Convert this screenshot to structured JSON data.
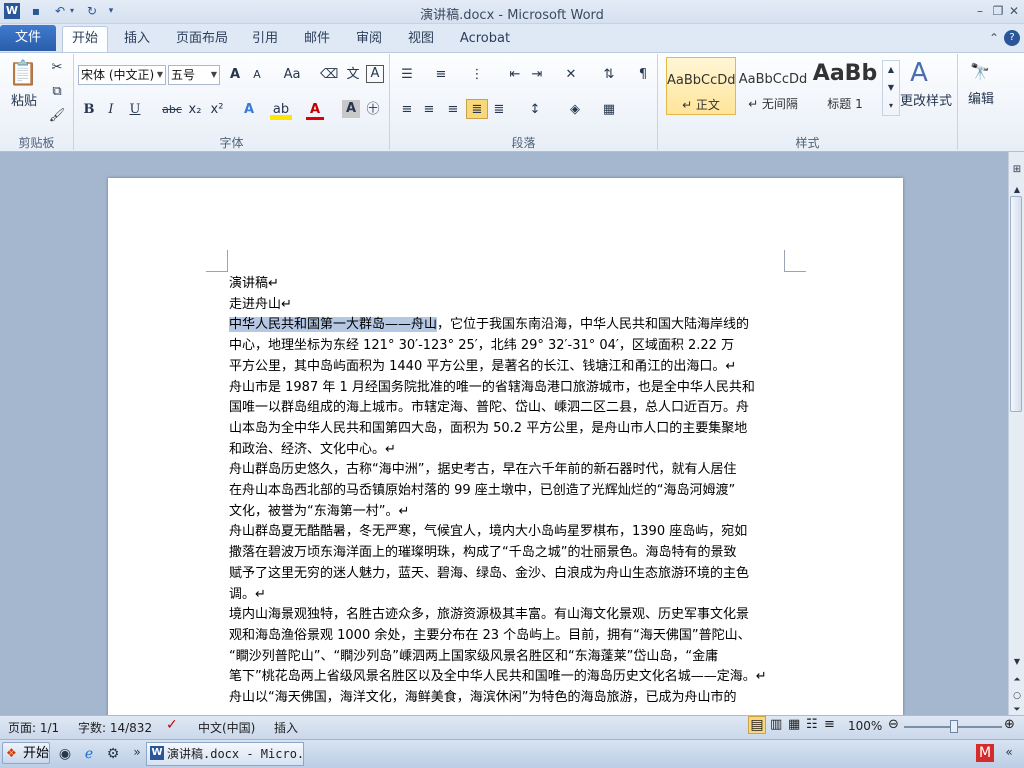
{
  "window": {
    "title": "演讲稿.docx - Microsoft Word"
  },
  "colors": {
    "accent": "#2b579a",
    "file_tab": "#2f65b5",
    "selection": "#b4c7e3",
    "doc_background": "#a5b7cf"
  },
  "tabs": [
    "开始",
    "插入",
    "页面布局",
    "引用",
    "邮件",
    "审阅",
    "视图",
    "Acrobat"
  ],
  "file_tab": "文件",
  "ribbon": {
    "clipboard": {
      "paste": "粘贴",
      "label": "剪贴板"
    },
    "font": {
      "name": "宋体 (中文正)",
      "size": "五号",
      "grow": "A",
      "shrink": "A",
      "case": "Aa",
      "bold": "B",
      "italic": "I",
      "underline": "U",
      "strike": "abc",
      "sub": "x₂",
      "sup": "x²",
      "color_a": "A",
      "highlight": "ab",
      "label": "字体"
    },
    "paragraph": {
      "label": "段落"
    },
    "styles": {
      "items": [
        {
          "preview": "AaBbCcDd",
          "name": "↵ 正文"
        },
        {
          "preview": "AaBbCcDd",
          "name": "↵ 无间隔"
        },
        {
          "preview": "AaBb",
          "name": "标题 1"
        }
      ],
      "change": "更改样式",
      "label": "样式"
    },
    "editing": {
      "label": "编辑"
    }
  },
  "document": {
    "lines": [
      "演讲稿↵",
      "走进舟山↵",
      "中华人民共和国第一大群岛——舟山，它位于我国东南沿海，中华人民共和国大陆海岸线的",
      "中心，地理坐标为东经 121° 30′-123° 25′，北纬 29° 32′-31° 04′，区域面积 2.22 万",
      "平方公里，其中岛屿面积为 1440 平方公里，是著名的长江、钱塘江和甬江的出海口。↵",
      "舟山市是 1987 年 1 月经国务院批准的唯一的省辖海岛港口旅游城市，也是全中华人民共和",
      "国唯一以群岛组成的海上城市。市辖定海、普陀、岱山、嵊泗二区二县，总人口近百万。舟",
      "山本岛为全中华人民共和国第四大岛，面积为 50.2 平方公里，是舟山市人口的主要集聚地",
      "和政治、经济、文化中心。↵",
      "舟山群岛历史悠久，古称“海中洲”，据史考古，早在六千年前的新石器时代，就有人居住",
      "在舟山本岛西北部的马岙镇原始村落的 99 座土墩中，已创造了光辉灿烂的“海岛河姆渡”",
      "文化，被誉为“东海第一村”。↵",
      "舟山群岛夏无酷酷暑，冬无严寒，气候宜人，境内大小岛屿星罗棋布，1390 座岛屿，宛如",
      "撒落在碧波万顷东海洋面上的璀璨明珠，构成了“千岛之城”的壮丽景色。海岛特有的景致",
      "赋予了这里无穷的迷人魅力，蓝天、碧海、绿岛、金沙、白浪成为舟山生态旅游环境的主色",
      "调。↵",
      "境内山海景观独特，名胜古迹众多，旅游资源极其丰富。有山海文化景观、历史军事文化景",
      "观和海岛渔俗景观 1000 余处，主要分布在 23 个岛屿上。目前，拥有“海天佛国”普陀山、",
      "“瞷沙列普陀山”、“瞷沙列岛”嵊泗两上国家级风景名胜区和“东海蓬莱”岱山岛，“金庸",
      "笔下”桃花岛两上省级风景名胜区以及全中华人民共和国唯一的海岛历史文化名城——定海。↵",
      "舟山以“海天佛国，海洋文化，海鲜美食，海滨休闲”为特色的海岛旅游，已成为舟山市的"
    ],
    "highlight_text": "中华人民共和国第一大群岛——舟山"
  },
  "status": {
    "page": "页面: 1/1",
    "words": "字数: 14/832",
    "language": "中文(中国)",
    "mode": "插入",
    "zoom": "100%"
  },
  "taskbar": {
    "start": "开始",
    "window": "演讲稿.docx - Micro..."
  }
}
